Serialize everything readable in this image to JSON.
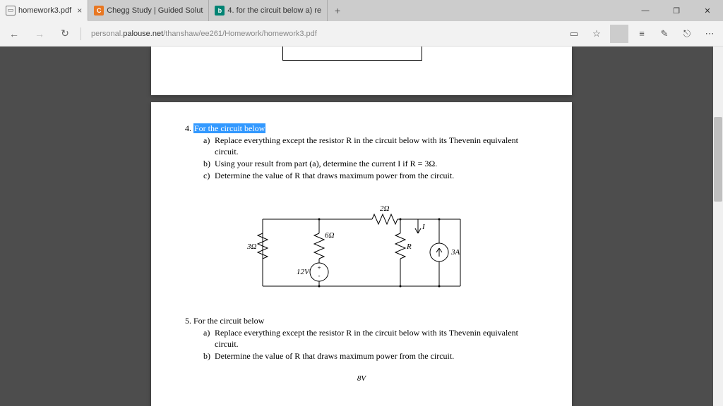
{
  "tabs": [
    {
      "title": "homework3.pdf",
      "favicon": "pdf",
      "active": true
    },
    {
      "title": "Chegg Study | Guided Solut",
      "favicon": "chegg",
      "active": false
    },
    {
      "title": "4. for the circuit below a) re",
      "favicon": "bing",
      "active": false
    }
  ],
  "url": {
    "prefix": "personal.",
    "host": "palouse.net",
    "path": "/thanshaw/ee261/Homework/homework3.pdf"
  },
  "problem4": {
    "number": "4.",
    "title": "For the circuit below",
    "items": [
      {
        "letter": "a)",
        "text": "Replace everything except the resistor R in the circuit below with its Thevenin equivalent circuit."
      },
      {
        "letter": "b)",
        "text": "Using your result from part (a), determine the current I if R = 3Ω."
      },
      {
        "letter": "c)",
        "text": "Determine the value of R that draws maximum power from the circuit."
      }
    ]
  },
  "circuit": {
    "r_left": "3Ω",
    "r_mid": "6Ω",
    "r_top": "2Ω",
    "r_load": "R",
    "v_src": "12V",
    "i_src": "3A",
    "i_label": "I"
  },
  "problem5": {
    "number": "5.",
    "title": "For the circuit below",
    "items": [
      {
        "letter": "a)",
        "text": "Replace everything except the resistor R in the circuit below with its Thevenin equivalent circuit."
      },
      {
        "letter": "b)",
        "text": "Determine the value of R that draws maximum power from the circuit."
      }
    ]
  },
  "frag_label": "8V"
}
